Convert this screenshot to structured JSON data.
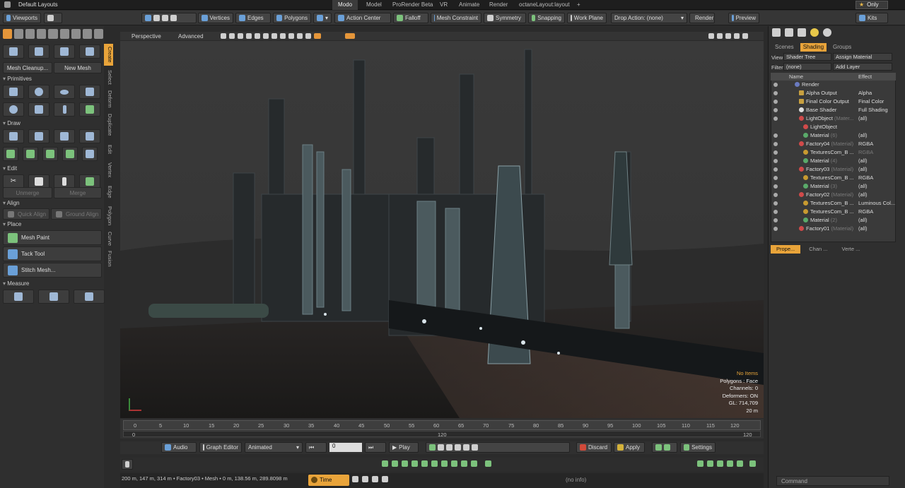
{
  "topbar": {
    "layout": "Default Layouts",
    "tabs": [
      "Modo",
      "Model",
      "ProRender Beta",
      "VR",
      "Animate",
      "Render",
      "octaneLayout:layout"
    ],
    "add": "+",
    "only": "Only"
  },
  "toolbar": {
    "viewports": "Viewports",
    "vertices": "Vertices",
    "edges": "Edges",
    "polygons": "Polygons",
    "action_center": "Action Center",
    "falloff": "Falloff",
    "mesh_constraint": "Mesh Constraint",
    "symmetry": "Symmetry",
    "snapping": "Snapping",
    "work_plane": "Work Plane",
    "drop_action": "Drop Action: (none)",
    "render": "Render",
    "preview": "Preview",
    "kits": "Kits"
  },
  "left": {
    "mesh_cleanup": "Mesh Cleanup...",
    "new_mesh": "New Mesh",
    "primitives": "Primitives",
    "draw": "Draw",
    "edit": "Edit",
    "unmerge": "Unmerge",
    "merge": "Merge",
    "align": "Align",
    "quick_align": "Quick Align",
    "ground_align": "Ground Align",
    "place": "Place",
    "mesh_paint": "Mesh Paint",
    "tack_tool": "Tack Tool",
    "stitch_mesh": "Stitch Mesh...",
    "measure": "Measure",
    "tabs": [
      "Create",
      "Select",
      "Deform",
      "Duplicate",
      "Edit",
      "Vertex",
      "Edge",
      "Polygon",
      "Curve",
      "Fusion"
    ]
  },
  "viewport": {
    "view": "Perspective",
    "mode": "Advanced",
    "info": {
      "no_items": "No Items",
      "polygons": "Polygons : Face",
      "channels": "Channels: 0",
      "deformers": "Deformers: ON",
      "gl": "GL: 714,709",
      "scale": "20 m"
    }
  },
  "timeline": {
    "ticks": [
      "0",
      "5",
      "10",
      "15",
      "20",
      "25",
      "30",
      "35",
      "40",
      "45",
      "50",
      "55",
      "60",
      "65",
      "70",
      "75",
      "80",
      "85",
      "90",
      "95",
      "100",
      "105",
      "110",
      "115",
      "120"
    ],
    "start": "0",
    "end": "120",
    "mid": "120",
    "mid2": "120"
  },
  "transport": {
    "audio": "Audio",
    "graph_editor": "Graph Editor",
    "animated": "Animated",
    "frame": "0",
    "play": "Play",
    "discard": "Discard",
    "apply": "Apply",
    "settings": "Settings"
  },
  "status": {
    "coords": "200 m, 147 m, 314 m • Factory03 • Mesh • 0 m, 138.56 m, 289.8098 m",
    "time": "Time",
    "info": "(no info)",
    "command": "Command"
  },
  "right": {
    "tabs": [
      "Scenes",
      "Shading",
      "Groups"
    ],
    "view_label": "View",
    "view": "Shader Tree",
    "assign": "Assign Material",
    "filter_label": "Filter",
    "filter": "(none)",
    "add_layer": "Add Layer",
    "col_name": "Name",
    "col_effect": "Effect",
    "rows": [
      {
        "name": "Render",
        "effect": "",
        "tag": ""
      },
      {
        "name": "Alpha Output",
        "effect": "Alpha",
        "tag": ""
      },
      {
        "name": "Final Color Output",
        "effect": "Final Color",
        "tag": ""
      },
      {
        "name": "Base Shader",
        "effect": "Full Shading",
        "tag": ""
      },
      {
        "name": "LightObject",
        "effect": "(all)",
        "tag": "(Mater..."
      },
      {
        "name": "LightObject",
        "effect": "",
        "tag": ""
      },
      {
        "name": "Material",
        "effect": "(all)",
        "tag": "(6)"
      },
      {
        "name": "Factory04",
        "effect": "RGBA",
        "tag": "(Material)"
      },
      {
        "name": "TexturesCom_B ...",
        "effect": "RGBA",
        "tag": ""
      },
      {
        "name": "Material",
        "effect": "(all)",
        "tag": "(4)"
      },
      {
        "name": "Factory03",
        "effect": "(all)",
        "tag": "(Material)"
      },
      {
        "name": "TexturesCom_B ...",
        "effect": "RGBA",
        "tag": ""
      },
      {
        "name": "Material",
        "effect": "(all)",
        "tag": "(3)"
      },
      {
        "name": "Factory02",
        "effect": "(all)",
        "tag": "(Material)"
      },
      {
        "name": "TexturesCom_B ...",
        "effect": "Luminous Col...",
        "tag": ""
      },
      {
        "name": "TexturesCom_B ...",
        "effect": "RGBA",
        "tag": ""
      },
      {
        "name": "Material",
        "effect": "(all)",
        "tag": "(2)"
      },
      {
        "name": "Factory01",
        "effect": "(all)",
        "tag": "(Material)"
      }
    ],
    "bottom_tabs": [
      "Prope...",
      "Chan ...",
      "Verte ..."
    ]
  }
}
